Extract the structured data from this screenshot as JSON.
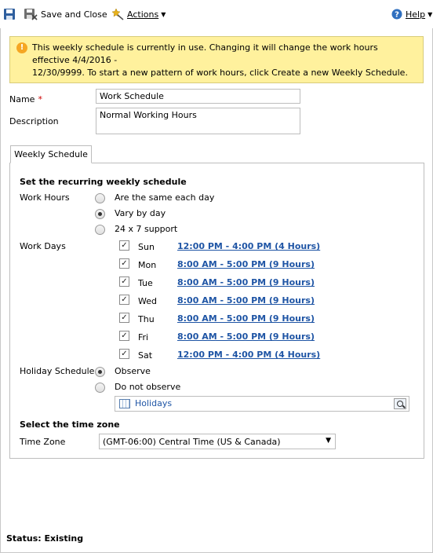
{
  "toolbar": {
    "save_and_close": "Save and Close",
    "actions": "Actions",
    "help": "Help"
  },
  "banner": {
    "line1": "This weekly schedule is currently in use. Changing it will change the work hours effective 4/4/2016 -",
    "line2": "12/30/9999. To start a new pattern of work hours, click Create a new Weekly Schedule."
  },
  "form": {
    "name_label": "Name",
    "required_mark": "*",
    "name_value": "Work Schedule",
    "description_label": "Description",
    "description_value": "Normal Working Hours"
  },
  "tab": {
    "label": "Weekly Schedule"
  },
  "schedule": {
    "section_title": "Set the recurring weekly schedule",
    "work_hours_label": "Work Hours",
    "work_hours_options": [
      {
        "label": "Are the same each day",
        "selected": false
      },
      {
        "label": "Vary by day",
        "selected": true
      },
      {
        "label": "24 x 7 support",
        "selected": false
      }
    ],
    "work_days_label": "Work Days",
    "days": [
      {
        "day": "Sun",
        "hours": "12:00 PM - 4:00 PM (4 Hours)",
        "checked": true
      },
      {
        "day": "Mon",
        "hours": "8:00 AM - 5:00 PM (9 Hours)",
        "checked": true
      },
      {
        "day": "Tue",
        "hours": "8:00 AM - 5:00 PM (9 Hours)",
        "checked": true
      },
      {
        "day": "Wed",
        "hours": "8:00 AM - 5:00 PM (9 Hours)",
        "checked": true
      },
      {
        "day": "Thu",
        "hours": "8:00 AM - 5:00 PM (9 Hours)",
        "checked": true
      },
      {
        "day": "Fri",
        "hours": "8:00 AM - 5:00 PM (9 Hours)",
        "checked": true
      },
      {
        "day": "Sat",
        "hours": "12:00 PM - 4:00 PM (4 Hours)",
        "checked": true
      }
    ],
    "holiday_label": "Holiday Schedule",
    "holiday_options": [
      {
        "label": "Observe",
        "selected": true
      },
      {
        "label": "Do not observe",
        "selected": false
      }
    ],
    "holiday_lookup_value": "Holidays"
  },
  "timezone": {
    "section_title": "Select the time zone",
    "label": "Time Zone",
    "value": "(GMT-06:00) Central Time (US & Canada)"
  },
  "status": {
    "text": "Status: Existing"
  },
  "colors": {
    "banner_bg": "#fff19d",
    "link": "#1f55a5",
    "required": "#cc0000"
  }
}
